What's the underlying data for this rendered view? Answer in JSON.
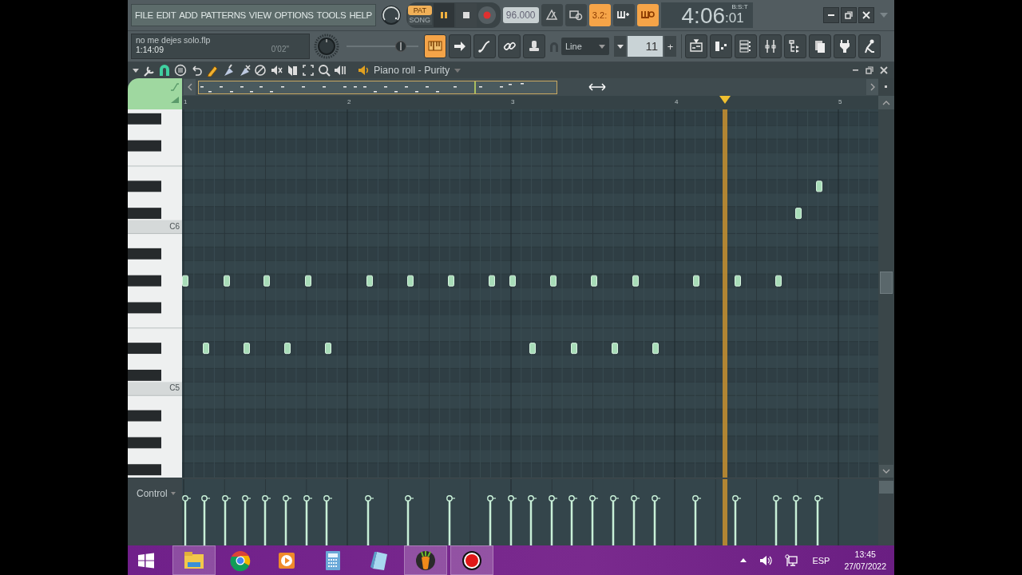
{
  "menu": [
    "FILE",
    "EDIT",
    "ADD",
    "PATTERNS",
    "VIEW",
    "OPTIONS",
    "TOOLS",
    "HELP"
  ],
  "transport": {
    "modes": [
      {
        "label": "PAT",
        "selected": true
      },
      {
        "label": "SONG",
        "selected": false
      }
    ],
    "playing": true,
    "tempo": "96.000"
  },
  "toggles": [
    {
      "kind": "metronome",
      "on": false
    },
    {
      "kind": "wait",
      "on": false
    },
    {
      "kind": "steps",
      "label": "3.2:",
      "on": true
    },
    {
      "kind": "overdub",
      "on": false
    },
    {
      "kind": "loop",
      "on": true
    }
  ],
  "time_display": {
    "main": "4:06",
    "sub": ":01",
    "unit": "B:S:T"
  },
  "pitch_slider": {
    "level": 0.8
  },
  "project": {
    "file": "no me dejes solo.flp",
    "time": "1:14:09",
    "duration": "0'02\""
  },
  "view_buttons": [
    {
      "kind": "piano",
      "on": true
    },
    {
      "kind": "arrow",
      "on": false
    },
    {
      "kind": "curve",
      "on": false
    },
    {
      "kind": "link",
      "on": false
    },
    {
      "kind": "stamp",
      "on": false
    }
  ],
  "snap": {
    "value": "Line"
  },
  "pattern_stepper": {
    "value": "11",
    "increment": "+"
  },
  "piano_roll": {
    "title": "Piano roll - Purity",
    "ruler": [
      "1",
      "2",
      "3",
      "4",
      "5"
    ],
    "keyboard_labels": [
      "C6",
      "C5"
    ],
    "event_label": "Control"
  },
  "taskbar": {
    "apps": [
      {
        "kind": "explorer",
        "active": true
      },
      {
        "kind": "chrome",
        "active": false
      },
      {
        "kind": "player",
        "active": false
      },
      {
        "kind": "calculator",
        "active": false
      },
      {
        "kind": "notepad",
        "active": false
      },
      {
        "kind": "fl",
        "active": true
      },
      {
        "kind": "recorder",
        "active": true
      }
    ],
    "language": "ESP",
    "time": "13:45",
    "date": "27/07/2022"
  }
}
